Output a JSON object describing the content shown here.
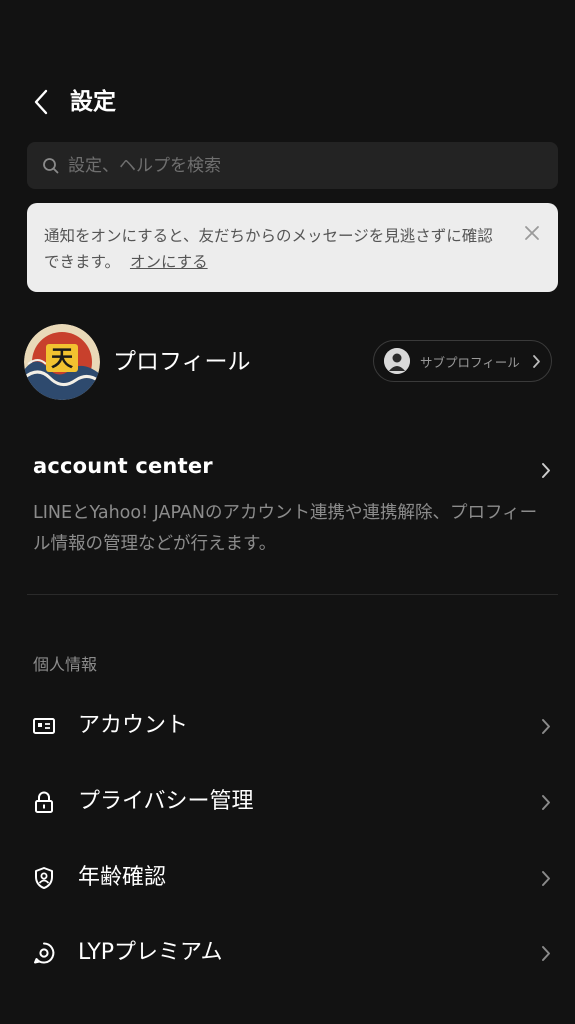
{
  "header": {
    "title": "設定"
  },
  "search": {
    "placeholder": "設定、ヘルプを検索",
    "value": ""
  },
  "notice": {
    "text": "通知をオンにすると、友だちからのメッセージを見逃さずに確認できます。",
    "link": "オンにする"
  },
  "profile": {
    "name": "プロフィール",
    "avatar_glyph": "天",
    "sub_profile_label": "サブプロフィール"
  },
  "account_center": {
    "title": "account center",
    "description": "LINEとYahoo! JAPANのアカウント連携や連携解除、プロフィール情報の管理などが行えます。"
  },
  "section": {
    "label": "個人情報",
    "items": [
      {
        "label": "アカウント",
        "icon": "id-card-icon"
      },
      {
        "label": "プライバシー管理",
        "icon": "lock-icon"
      },
      {
        "label": "年齢確認",
        "icon": "shield-person-icon"
      },
      {
        "label": "LYPプレミアム",
        "icon": "premium-badge-icon"
      }
    ]
  },
  "colors": {
    "background": "#121212",
    "search_bg": "#232323",
    "notice_bg": "#ededed",
    "secondary_text": "#8c8c8c"
  }
}
